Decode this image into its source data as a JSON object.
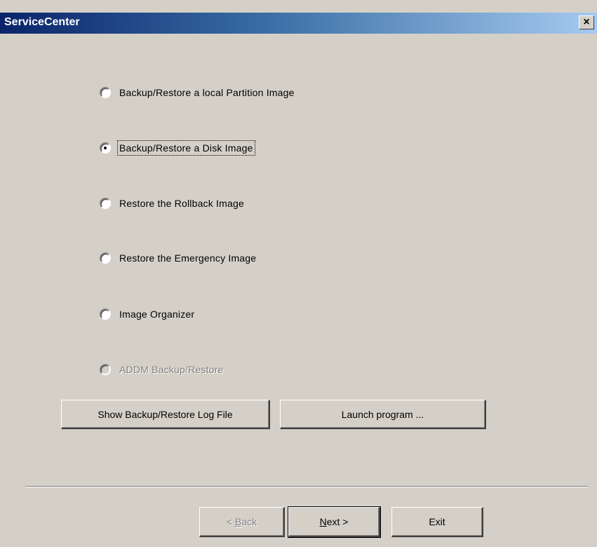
{
  "window": {
    "title": "ServiceCenter",
    "close_label": "×"
  },
  "options": [
    {
      "label": "Backup/Restore a local Partition Image",
      "checked": false,
      "disabled": false
    },
    {
      "label": "Backup/Restore a Disk Image",
      "checked": true,
      "disabled": false
    },
    {
      "label": "Restore the Rollback Image",
      "checked": false,
      "disabled": false
    },
    {
      "label": "Restore the Emergency Image",
      "checked": false,
      "disabled": false
    },
    {
      "label": "Image Organizer",
      "checked": false,
      "disabled": false
    },
    {
      "label": "ADDM Backup/Restore",
      "checked": false,
      "disabled": true
    }
  ],
  "buttons": {
    "show_log": "Show Backup/Restore Log File",
    "launch": "Launch program ...",
    "back_prefix": "< ",
    "back_accel": "B",
    "back_rest": "ack",
    "next_accel": "N",
    "next_rest": "ext >",
    "exit": "Exit"
  }
}
